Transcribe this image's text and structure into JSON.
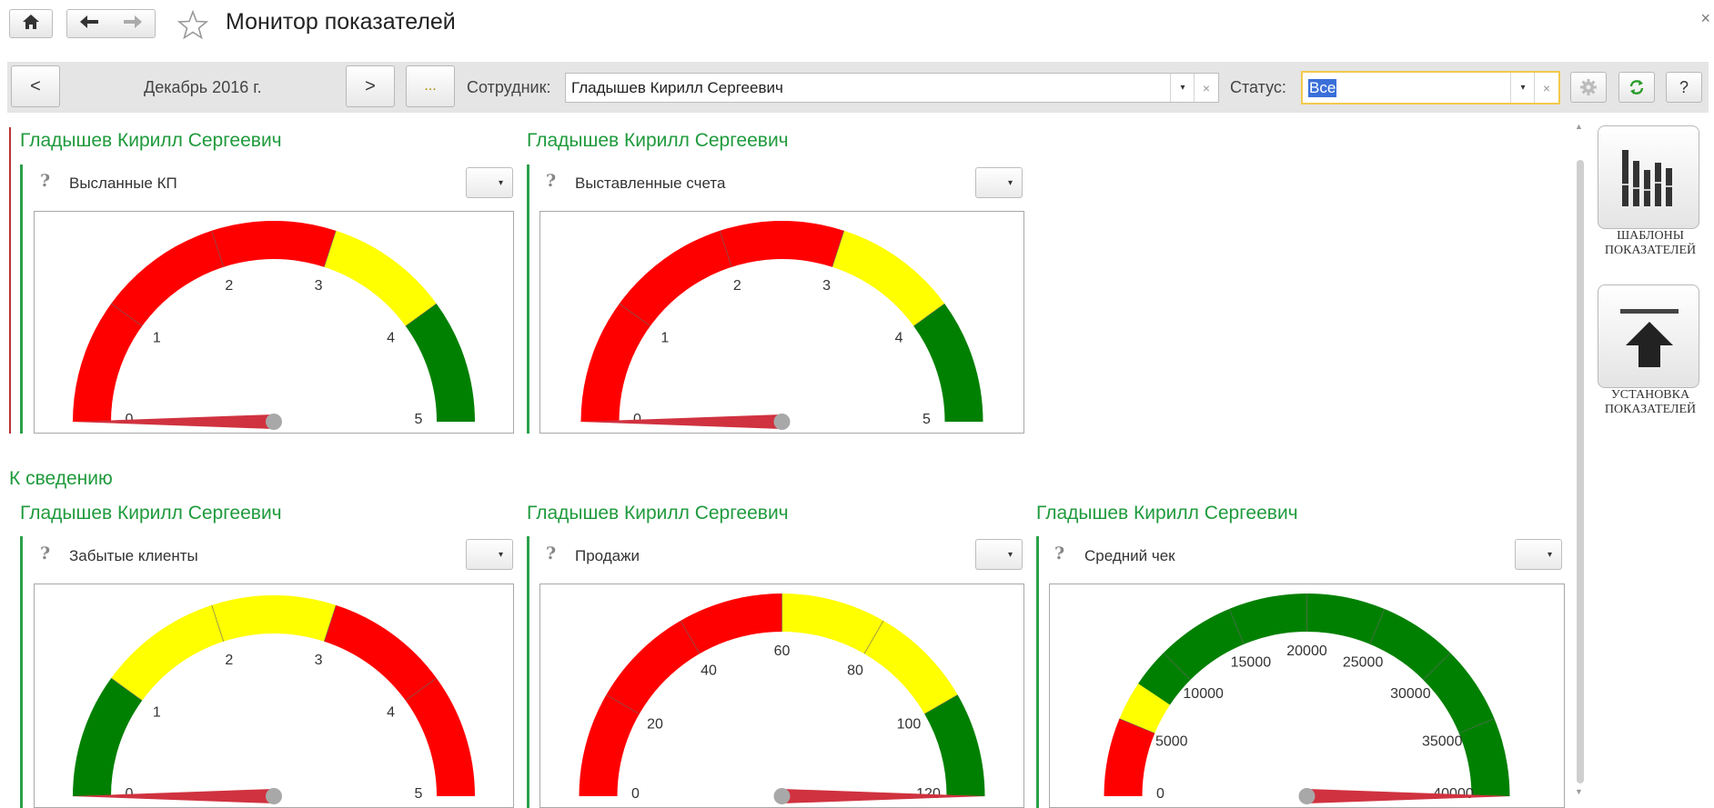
{
  "window": {
    "title": "Монитор показателей",
    "close_glyph": "×",
    "icons": {
      "home": "home-icon",
      "back": "arrow-left-icon",
      "forward": "arrow-right-icon",
      "favorite": "star-icon"
    }
  },
  "toolbar": {
    "prev_label": "<",
    "period": "Декабрь 2016 г.",
    "next_label": ">",
    "more_label": "...",
    "employee_label": "Сотрудник:",
    "employee_value": "Гладышев Кирилл Сергеевич",
    "status_label": "Статус:",
    "status_value": "Все",
    "dropdown_glyph": "▾",
    "clear_glyph": "×",
    "help_label": "?",
    "icons": {
      "settings": "gear-icon",
      "refresh": "refresh-icon"
    }
  },
  "colors": {
    "red": "#ff0000",
    "yellow": "#ffff00",
    "green": "#008000",
    "accent": "#1f9a3c",
    "needle": "#d0323f"
  },
  "top_group": {
    "cards": [
      {
        "employee": "Гладышев Кирилл Сергеевич",
        "indicator": "Высланные КП",
        "help": "?",
        "dropdown": "▾",
        "gauge": {
          "min": 0,
          "max": 5,
          "value": 0,
          "bands": [
            {
              "from": 0,
              "to": 3,
              "color": "red"
            },
            {
              "from": 3,
              "to": 4,
              "color": "yellow"
            },
            {
              "from": 4,
              "to": 5,
              "color": "green"
            }
          ],
          "ticks": [
            "0",
            "1",
            "2",
            "3",
            "4",
            "5"
          ]
        }
      },
      {
        "employee": "Гладышев Кирилл Сергеевич",
        "indicator": "Выставленные счета",
        "help": "?",
        "dropdown": "▾",
        "gauge": {
          "min": 0,
          "max": 5,
          "value": 0,
          "bands": [
            {
              "from": 0,
              "to": 3,
              "color": "red"
            },
            {
              "from": 3,
              "to": 4,
              "color": "yellow"
            },
            {
              "from": 4,
              "to": 5,
              "color": "green"
            }
          ],
          "ticks": [
            "0",
            "1",
            "2",
            "3",
            "4",
            "5"
          ]
        }
      }
    ]
  },
  "info_group": {
    "title": "К сведению",
    "cards": [
      {
        "employee": "Гладышев Кирилл Сергеевич",
        "indicator": "Забытые клиенты",
        "help": "?",
        "dropdown": "▾",
        "gauge": {
          "min": 0,
          "max": 5,
          "value": 0,
          "bands": [
            {
              "from": 0,
              "to": 1,
              "color": "green"
            },
            {
              "from": 1,
              "to": 3,
              "color": "yellow"
            },
            {
              "from": 3,
              "to": 5,
              "color": "red"
            }
          ],
          "ticks": [
            "0",
            "1",
            "2",
            "3",
            "4",
            "5"
          ]
        }
      },
      {
        "employee": "Гладышев Кирилл Сергеевич",
        "indicator": "Продажи",
        "help": "?",
        "dropdown": "▾",
        "gauge": {
          "min": 0,
          "max": 120,
          "value": 120,
          "bands": [
            {
              "from": 0,
              "to": 60,
              "color": "red"
            },
            {
              "from": 60,
              "to": 100,
              "color": "yellow"
            },
            {
              "from": 100,
              "to": 120,
              "color": "green"
            }
          ],
          "ticks": [
            "0",
            "20",
            "40",
            "60",
            "80",
            "100",
            "120"
          ]
        }
      },
      {
        "employee": "Гладышев Кирилл Сергеевич",
        "indicator": "Средний чек",
        "help": "?",
        "dropdown": "▾",
        "gauge": {
          "min": 0,
          "max": 40000,
          "value": 40000,
          "bands": [
            {
              "from": 0,
              "to": 5000,
              "color": "red"
            },
            {
              "from": 5000,
              "to": 7500,
              "color": "yellow"
            },
            {
              "from": 7500,
              "to": 40000,
              "color": "green"
            }
          ],
          "ticks": [
            "0",
            "5000",
            "10000",
            "15000",
            "20000",
            "25000",
            "30000",
            "35000",
            "40000"
          ]
        }
      }
    ]
  },
  "side_panel": {
    "templates_label": "ШАБЛОНЫ ПОКАЗАТЕЛЕЙ",
    "install_label": "УСТАНОВКА ПОКАЗАТЕЛЕЙ",
    "icons": {
      "templates": "bar-chart-icon",
      "install": "upload-arrow-icon"
    }
  }
}
